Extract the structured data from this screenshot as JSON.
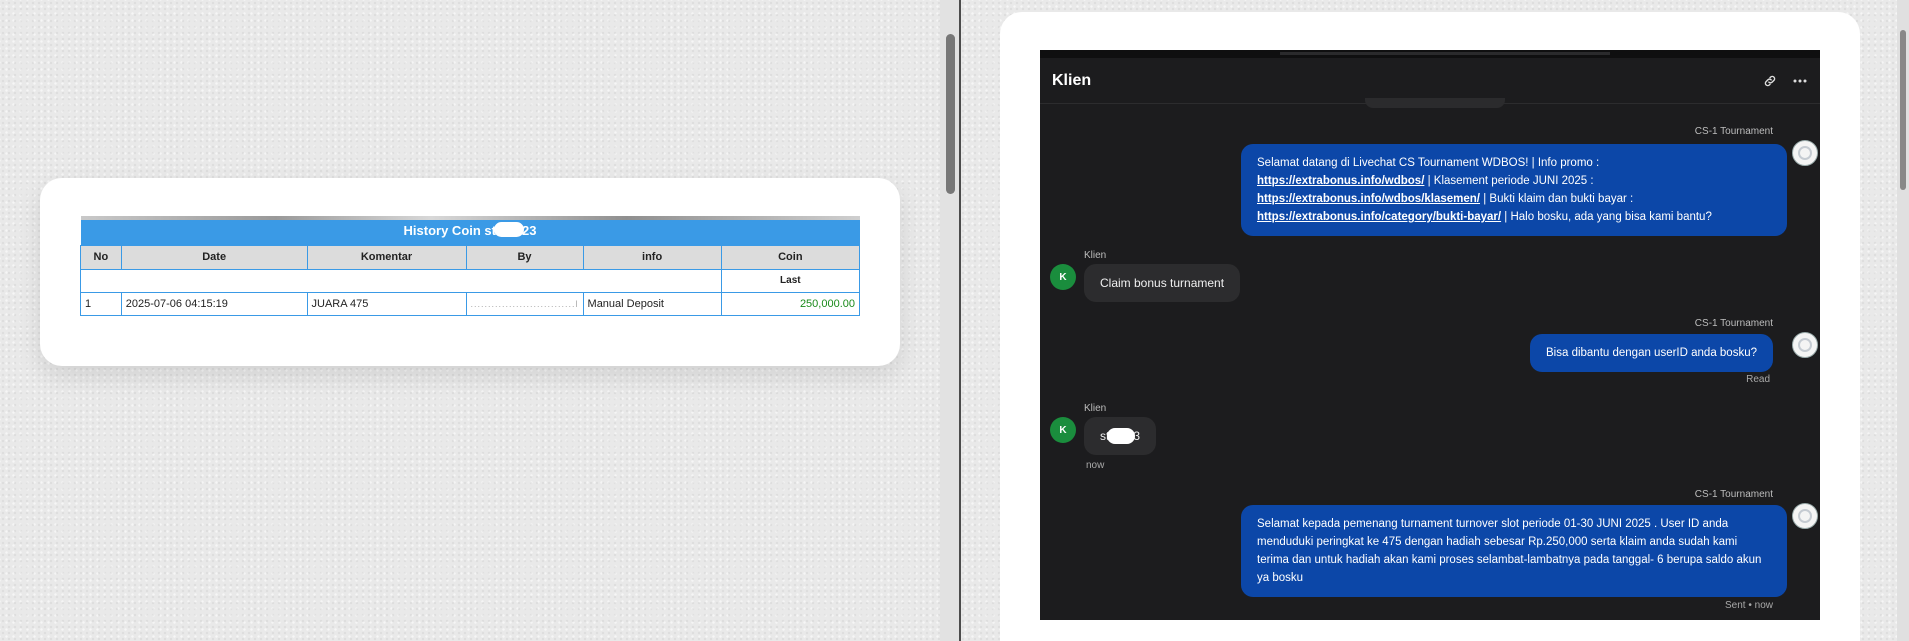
{
  "history": {
    "title_prefix": "History Coin st",
    "title_suffix": "23",
    "columns": [
      "No",
      "Date",
      "Komentar",
      "By",
      "info",
      "Coin"
    ],
    "sub_header": "Last",
    "rows": [
      {
        "no": "1",
        "date": "2025-07-06 04:15:19",
        "komentar": "JUARA 475",
        "by": "..............................l",
        "info": "Manual Deposit",
        "coin": "250,000.00"
      }
    ]
  },
  "chat": {
    "title": "Klien",
    "agent_name": "CS-1 Tournament",
    "client_name": "Klien",
    "client_initial": "K",
    "messages": {
      "m1": {
        "text_1": "Selamat datang di Livechat CS Tournament WDBOS! | Info promo :",
        "link_1": "https://extrabonus.info/wdbos/",
        "text_2": " | Klasement periode JUNI 2025 :",
        "link_2": "https://extrabonus.info/wdbos/klasemen/",
        "text_3": " | Bukti klaim dan bukti bayar :",
        "link_3": "https://extrabonus.info/category/bukti-bayar/",
        "text_4": " | Halo bosku, ada yang bisa kami bantu?"
      },
      "m2": "Claim bonus turnament",
      "m3": "Bisa dibantu dengan userID anda bosku?",
      "m3_status": "Read",
      "m4_prefix": "st",
      "m4_suffix": "3",
      "m4_time": "now",
      "m5": "Selamat kepada pemenang turnament turnover slot periode 01-30 JUNI 2025 . User ID anda menduduki peringkat ke 475 dengan hadiah sebesar Rp.250,000 serta klaim anda sudah kami terima dan untuk hadiah akan kami proses selambat-lambatnya pada tanggal- 6 berupa saldo akun ya bosku",
      "m5_status": "Sent • now"
    }
  },
  "colors": {
    "table_accent": "#3a9ae6",
    "coin_green": "#1a8a1a",
    "agent_bubble": "#0c47a8",
    "client_bubble": "#2c2c2e",
    "chat_bg": "#1c1c1e",
    "avatar_green": "#1a8d3d"
  },
  "icons": [
    "link-icon",
    "more-options-icon"
  ]
}
